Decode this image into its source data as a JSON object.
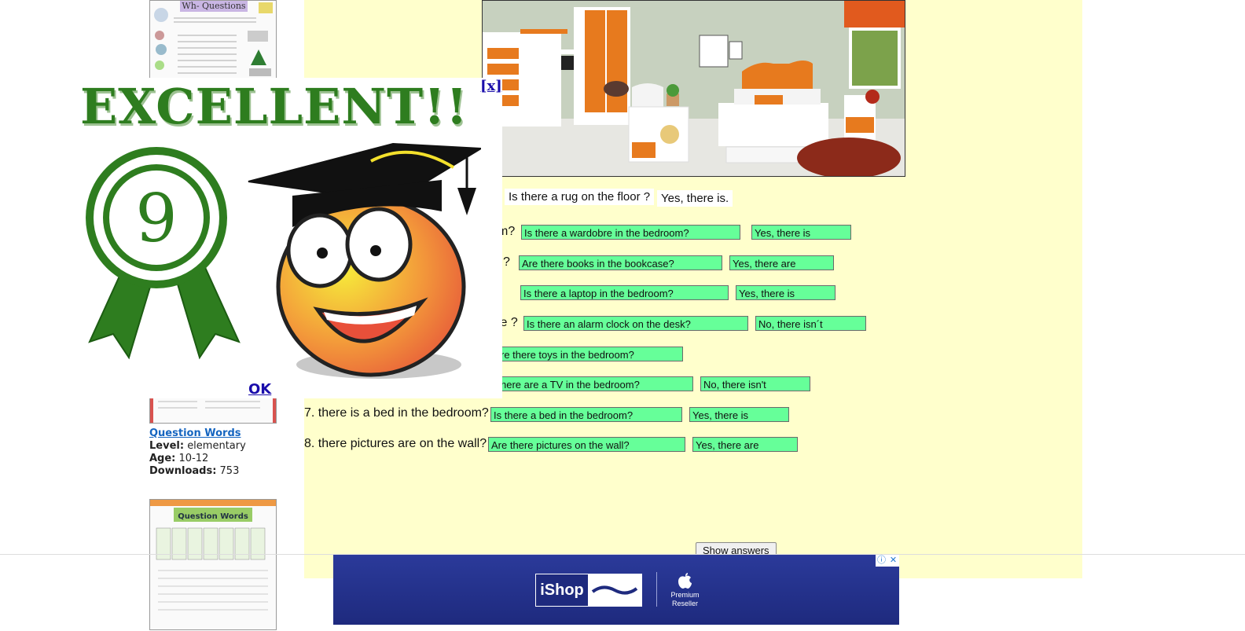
{
  "sidebar": {
    "worksheet_title": "Wh- Questions",
    "item": {
      "title": "Question Words",
      "level_label": "Level:",
      "level": "elementary",
      "age_label": "Age:",
      "age": "10-12",
      "downloads_label": "Downloads:",
      "downloads": "753"
    },
    "bottom_thumb_title": "Question Words"
  },
  "exercise": {
    "example": {
      "question": "Is there a rug on the floor ?",
      "answer": "Yes, there is."
    },
    "rows": [
      {
        "prompt": "m?",
        "question": "Is there a wardobre in the bedroom?",
        "answer": "Yes, there is"
      },
      {
        "prompt": "?",
        "question": "Are there books in the bookcase?",
        "answer": "Yes, there are"
      },
      {
        "prompt": "",
        "question": "Is there a laptop in the bedroom?",
        "answer": "Yes, there is"
      },
      {
        "prompt": "le ?",
        "question": "Is there an alarm clock on the desk?",
        "answer": "No, there isn´t"
      },
      {
        "prompt": "",
        "question": "re there toys in the bedroom?",
        "answer": ""
      },
      {
        "prompt": "",
        "question": "here are a TV in the bedroom?",
        "answer": "No, there isn't"
      },
      {
        "prompt": "7. there is a bed in the bedroom?",
        "question": "Is there a bed in the bedroom?",
        "answer": "Yes, there is"
      },
      {
        "prompt": "8. there pictures are on the wall?",
        "question": "Are there pictures on the wall?",
        "answer": "Yes, there are"
      }
    ],
    "show_answers_label": "Show answers"
  },
  "popup": {
    "close_label": "[x]",
    "headline": "EXCELLENT!!",
    "score": "9",
    "ok_label": "OK"
  },
  "ad": {
    "brand": "iShop",
    "partner_text": "Premium Reseller",
    "info_icon": "info-icon",
    "close_icon": "close-icon"
  },
  "colors": {
    "panel_bg": "#ffffcc",
    "input_bg": "#66ff99",
    "ribbon_green": "#2e7d1f",
    "ad_blue": "#1e2a7e",
    "link_blue": "#1a0dab"
  }
}
